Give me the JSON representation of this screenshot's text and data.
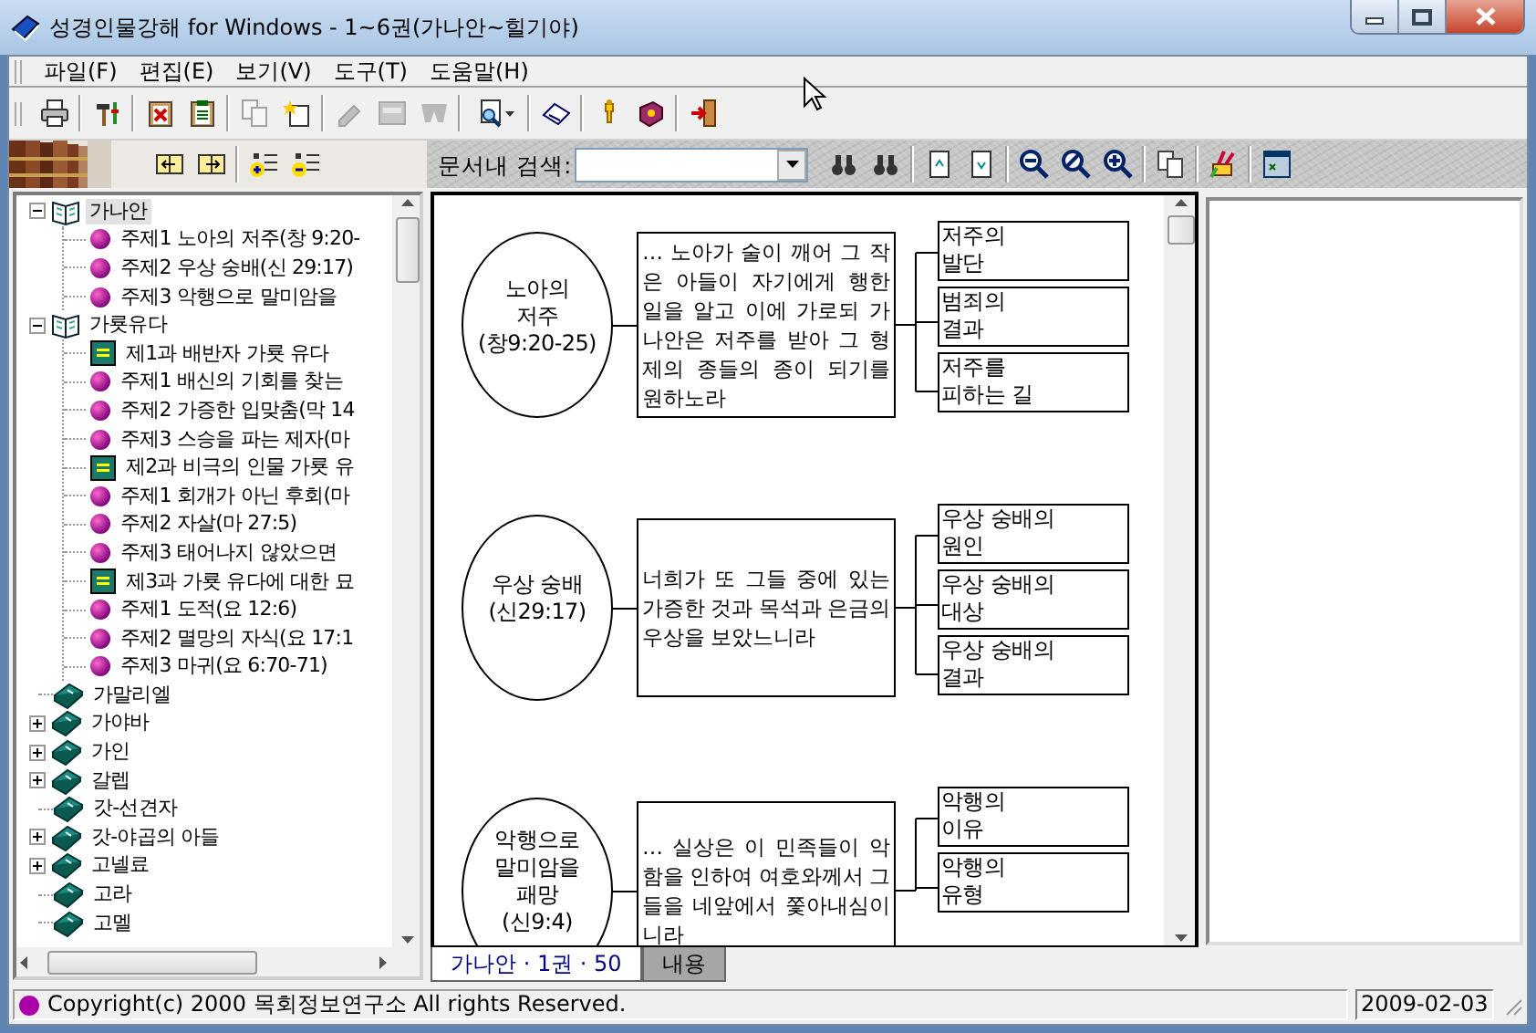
{
  "window": {
    "title": "성경인물강해 for Windows - 1~6권(가나안~힐기야)"
  },
  "menu": [
    "파일(F)",
    "편집(E)",
    "보기(V)",
    "도구(T)",
    "도움말(H)"
  ],
  "toolbar": [
    {
      "disabled": false
    },
    {
      "disabled": false
    },
    {
      "disabled": false
    },
    {
      "disabled": false
    },
    {
      "disabled": true
    },
    {
      "disabled": false
    },
    {
      "disabled": true
    },
    {
      "disabled": true
    },
    {
      "disabled": true
    },
    {
      "disabled": false
    },
    {
      "disabled": false
    },
    {
      "disabled": false
    },
    {
      "disabled": false
    },
    {
      "disabled": false
    }
  ],
  "search": {
    "label": "문서내 검색:"
  },
  "tree": [
    {
      "label": "가나안",
      "expandable": true,
      "expanded": true,
      "selected": true,
      "children": [
        {
          "label": "주제1 노아의 저주(창 9:20-",
          "kind": "topic",
          "selected": false
        },
        {
          "label": "주제2 우상 숭배(신 29:17)",
          "kind": "topic",
          "selected": false
        },
        {
          "label": "주제3 악행으로 말미암을",
          "kind": "topic",
          "selected": false
        }
      ]
    },
    {
      "label": "가룟유다",
      "expandable": true,
      "expanded": true,
      "selected": false,
      "children": [
        {
          "label": "제1과 배반자 가룟 유다",
          "kind": "lesson",
          "selected": false
        },
        {
          "label": "주제1  배신의 기회를 찾는",
          "kind": "topic",
          "selected": false
        },
        {
          "label": "주제2  가증한 입맞춤(막 14",
          "kind": "topic",
          "selected": false
        },
        {
          "label": "주제3  스승을 파는 제자(마",
          "kind": "topic",
          "selected": false
        },
        {
          "label": "제2과 비극의 인물 가룟 유",
          "kind": "lesson",
          "selected": false
        },
        {
          "label": "주제1  회개가 아닌 후회(마",
          "kind": "topic",
          "selected": false
        },
        {
          "label": "주제2  자살(마 27:5)",
          "kind": "topic",
          "selected": false
        },
        {
          "label": "주제3  태어나지 않았으면",
          "kind": "topic",
          "selected": false
        },
        {
          "label": "제3과 가룟 유다에 대한 묘",
          "kind": "lesson",
          "selected": false
        },
        {
          "label": "주제1  도적(요 12:6)",
          "kind": "topic",
          "selected": false
        },
        {
          "label": "주제2  멸망의 자식(요 17:1",
          "kind": "topic",
          "selected": false
        },
        {
          "label": "주제3  마귀(요 6:70-71)",
          "kind": "topic",
          "selected": false
        }
      ]
    },
    {
      "label": "가말리엘",
      "expandable": false,
      "expanded": false,
      "selected": false
    },
    {
      "label": "가야바",
      "expandable": true,
      "expanded": false,
      "selected": false
    },
    {
      "label": "가인",
      "expandable": true,
      "expanded": false,
      "selected": false
    },
    {
      "label": "갈렙",
      "expandable": true,
      "expanded": false,
      "selected": false
    },
    {
      "label": "갓-선견자",
      "expandable": false,
      "expanded": false,
      "selected": false
    },
    {
      "label": "갓-야곱의 아들",
      "expandable": true,
      "expanded": false,
      "selected": false
    },
    {
      "label": "고넬료",
      "expandable": true,
      "expanded": false,
      "selected": false
    },
    {
      "label": "고라",
      "expandable": false,
      "expanded": false,
      "selected": false
    },
    {
      "label": "고멜",
      "expandable": false,
      "expanded": false,
      "selected": false
    }
  ],
  "diagram": {
    "rows": [
      {
        "title": "노아의\n저주",
        "reference": "(창9:20-25)",
        "text": "… 노아가 술이 깨어 그 작은 아들이 자기에게 행한 일을 알고 이에 가로되 가나안은 저주를 받아 그 형제의 종들의 종이 되기를 원하노라",
        "points": [
          {
            "label": "저주의\n발단"
          },
          {
            "label": "범죄의\n결과"
          },
          {
            "label": "저주를\n피하는 길"
          }
        ]
      },
      {
        "title": "우상 숭배",
        "reference": "(신29:17)",
        "text": "너희가 또 그들 중에 있는 가증한 것과 목석과 은금의 우상을 보았느니라",
        "points": [
          {
            "label": "우상 숭배의\n원인"
          },
          {
            "label": "우상 숭배의\n대상"
          },
          {
            "label": "우상 숭배의\n결과"
          }
        ]
      },
      {
        "title": "악행으로\n말미암을\n패망",
        "reference": "(신9:4)",
        "text": "… 실상은 이 민족들이 악함을 인하여 여호와께서 그들을 네앞에서 쫓아내심이니라",
        "points": [
          {
            "label": "악행의\n이유"
          },
          {
            "label": "악행의\n유형"
          }
        ]
      }
    ]
  },
  "tabs": [
    {
      "label": "가나안 · 1권 · 50",
      "selected": true
    },
    {
      "label": "내용",
      "selected": false
    }
  ],
  "status_bar": {
    "text": "Copyright(c) 2000  목회정보연구소 All rights Reserved.",
    "date": "2009-02-03"
  }
}
